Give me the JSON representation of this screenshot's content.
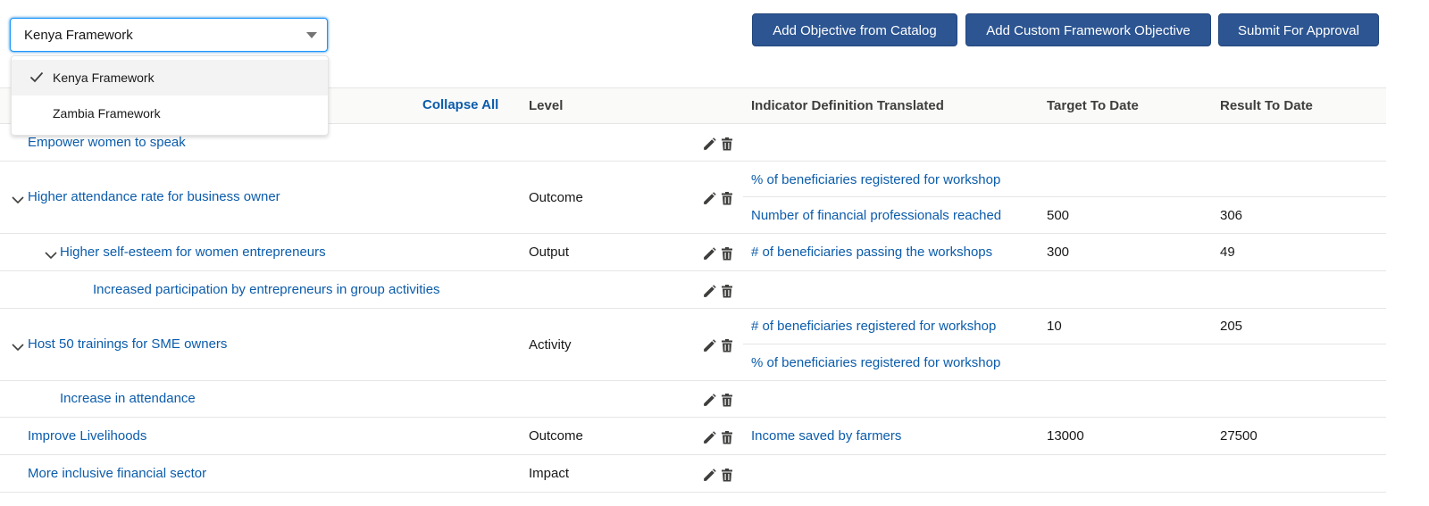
{
  "framework_select": {
    "value": "Kenya Framework",
    "options": [
      {
        "label": "Kenya Framework",
        "selected": true
      },
      {
        "label": "Zambia Framework",
        "selected": false
      }
    ]
  },
  "toolbar": {
    "add_from_catalog": "Add Objective from Catalog",
    "add_custom": "Add Custom Framework Objective",
    "submit": "Submit For Approval"
  },
  "table": {
    "collapse_all": "Collapse All",
    "headers": {
      "level": "Level",
      "indicator": "Indicator Definition Translated",
      "target": "Target To Date",
      "result": "Result To Date"
    },
    "rows": [
      {
        "objective": "Empower women to speak",
        "level": "",
        "indicators": []
      },
      {
        "objective": "Higher attendance rate for business owner",
        "level": "Outcome",
        "expanded": true,
        "indicators": [
          {
            "name": "% of beneficiaries registered for workshop",
            "target": "",
            "result": ""
          },
          {
            "name": "Number of financial professionals reached",
            "target": "500",
            "result": "306"
          }
        ]
      },
      {
        "objective": "Higher self-esteem for women entrepreneurs",
        "level": "Output",
        "expanded": true,
        "indicators": [
          {
            "name": "# of beneficiaries passing the workshops",
            "target": "300",
            "result": "49"
          }
        ]
      },
      {
        "objective": "Increased participation by entrepreneurs in group activities",
        "level": "",
        "indicators": []
      },
      {
        "objective": "Host 50 trainings for SME owners",
        "level": "Activity",
        "expanded": true,
        "indicators": [
          {
            "name": "# of beneficiaries registered for workshop",
            "target": "10",
            "result": "205"
          },
          {
            "name": "% of beneficiaries registered for workshop",
            "target": "",
            "result": ""
          }
        ]
      },
      {
        "objective": "Increase in attendance",
        "level": "",
        "indicators": []
      },
      {
        "objective": "Improve Livelihoods",
        "level": "Outcome",
        "indicators": [
          {
            "name": "Income saved by farmers",
            "target": "13000",
            "result": "27500"
          }
        ]
      },
      {
        "objective": "More inclusive financial sector",
        "level": "Impact",
        "indicators": []
      }
    ]
  },
  "icons": {
    "edit": "pencil-icon",
    "delete": "trash-icon",
    "expand": "chevron-down-icon",
    "check": "check-icon",
    "caret": "caret-down-icon"
  },
  "colors": {
    "link": "#0b5cab",
    "button": "#2c5592",
    "focus": "#1b96ff"
  }
}
